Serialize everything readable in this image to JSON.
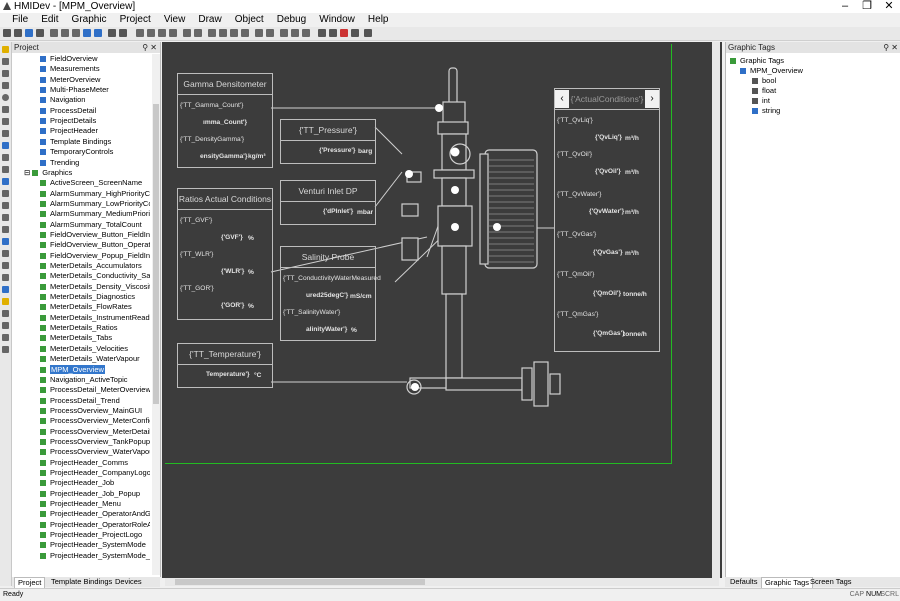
{
  "window": {
    "title": "HMIDev - [MPM_Overview]",
    "minimize": "–",
    "maximize": "❐",
    "close": "✕"
  },
  "menu": [
    "File",
    "Edit",
    "Graphic",
    "Project",
    "View",
    "Draw",
    "Object",
    "Debug",
    "Window",
    "Help"
  ],
  "project_panel": {
    "title": "Project",
    "pin": "⚲ ✕",
    "items": [
      {
        "label": "FieldOverview",
        "level": 2,
        "icon": "pg"
      },
      {
        "label": "Measurements",
        "level": 2,
        "icon": "pg"
      },
      {
        "label": "MeterOverview",
        "level": 2,
        "icon": "pg"
      },
      {
        "label": "Multi-PhaseMeter",
        "level": 2,
        "icon": "pg"
      },
      {
        "label": "Navigation",
        "level": 2,
        "icon": "pg"
      },
      {
        "label": "ProcessDetail",
        "level": 2,
        "icon": "pg"
      },
      {
        "label": "ProjectDetails",
        "level": 2,
        "icon": "pg"
      },
      {
        "label": "ProjectHeader",
        "level": 2,
        "icon": "pg"
      },
      {
        "label": "Template Bindings",
        "level": 2,
        "icon": "pg"
      },
      {
        "label": "TemporaryControls",
        "level": 2,
        "icon": "pg"
      },
      {
        "label": "Trending",
        "level": 2,
        "icon": "pg"
      },
      {
        "label": "Graphics",
        "level": 1,
        "icon": "gr",
        "expander": "⊟"
      },
      {
        "label": "ActiveScreen_ScreenName",
        "level": 2,
        "icon": "gr"
      },
      {
        "label": "AlarmSummary_HighPriorityCount",
        "level": 2,
        "icon": "gr"
      },
      {
        "label": "AlarmSummary_LowPriorityCount",
        "level": 2,
        "icon": "gr"
      },
      {
        "label": "AlarmSummary_MediumPriorityCount",
        "level": 2,
        "icon": "gr"
      },
      {
        "label": "AlarmSummary_TotalCount",
        "level": 2,
        "icon": "gr"
      },
      {
        "label": "FieldOverview_Button_FieldInfo",
        "level": 2,
        "icon": "gr"
      },
      {
        "label": "FieldOverview_Button_OperatorInfo",
        "level": 2,
        "icon": "gr"
      },
      {
        "label": "FieldOverview_Popup_FieldInfo",
        "level": 2,
        "icon": "gr"
      },
      {
        "label": "MeterDetails_Accumulators",
        "level": 2,
        "icon": "gr"
      },
      {
        "label": "MeterDetails_Conductivity_Salinity",
        "level": 2,
        "icon": "gr"
      },
      {
        "label": "MeterDetails_Density_Viscosity",
        "level": 2,
        "icon": "gr"
      },
      {
        "label": "MeterDetails_Diagnostics",
        "level": 2,
        "icon": "gr"
      },
      {
        "label": "MeterDetails_FlowRates",
        "level": 2,
        "icon": "gr"
      },
      {
        "label": "MeterDetails_InstrumentReadings",
        "level": 2,
        "icon": "gr"
      },
      {
        "label": "MeterDetails_Ratios",
        "level": 2,
        "icon": "gr"
      },
      {
        "label": "MeterDetails_Tabs",
        "level": 2,
        "icon": "gr"
      },
      {
        "label": "MeterDetails_Velocities",
        "level": 2,
        "icon": "gr"
      },
      {
        "label": "MeterDetails_WaterVapour",
        "level": 2,
        "icon": "gr"
      },
      {
        "label": "MPM_Overview",
        "level": 2,
        "icon": "gr",
        "selected": true
      },
      {
        "label": "Navigation_ActiveTopic",
        "level": 2,
        "icon": "gr"
      },
      {
        "label": "ProcessDetail_MeterOverview",
        "level": 2,
        "icon": "gr"
      },
      {
        "label": "ProcessDetail_Trend",
        "level": 2,
        "icon": "gr"
      },
      {
        "label": "ProcessOverview_MainGUI",
        "level": 2,
        "icon": "gr"
      },
      {
        "label": "ProcessOverview_MeterConfig",
        "level": 2,
        "icon": "gr"
      },
      {
        "label": "ProcessOverview_MeterDetails",
        "level": 2,
        "icon": "gr"
      },
      {
        "label": "ProcessOverview_TankPopup",
        "level": 2,
        "icon": "gr"
      },
      {
        "label": "ProcessOverview_WaterVapour",
        "level": 2,
        "icon": "gr"
      },
      {
        "label": "ProjectHeader_Comms",
        "level": 2,
        "icon": "gr"
      },
      {
        "label": "ProjectHeader_CompanyLogoAndProje",
        "level": 2,
        "icon": "gr"
      },
      {
        "label": "ProjectHeader_Job",
        "level": 2,
        "icon": "gr"
      },
      {
        "label": "ProjectHeader_Job_Popup",
        "level": 2,
        "icon": "gr"
      },
      {
        "label": "ProjectHeader_Menu",
        "level": 2,
        "icon": "gr"
      },
      {
        "label": "ProjectHeader_OperatorAndGroup",
        "level": 2,
        "icon": "gr"
      },
      {
        "label": "ProjectHeader_OperatorRoleAndField",
        "level": 2,
        "icon": "gr"
      },
      {
        "label": "ProjectHeader_ProjectLogo",
        "level": 2,
        "icon": "gr"
      },
      {
        "label": "ProjectHeader_SystemMode",
        "level": 2,
        "icon": "gr"
      },
      {
        "label": "ProjectHeader_SystemMode_Popup",
        "level": 2,
        "icon": "gr"
      }
    ],
    "tabs": [
      "Project",
      "Template Bindings",
      "Devices"
    ]
  },
  "canvas": {
    "gamma": {
      "title": "Gamma Densitometer",
      "rows": [
        {
          "label": "{'TT_Gamma_Count'}",
          "value": "ımma_Count'}",
          "unit": ""
        },
        {
          "label": "{'TT_DensityGamma'}",
          "value": "ensityGamma'}",
          "unit": "kg/m³"
        }
      ]
    },
    "pressure": {
      "title": "{'TT_Pressure'}",
      "value": "{'Pressure'}",
      "unit": "barg"
    },
    "venturi": {
      "title": "Venturi Inlet DP",
      "value": "{'dPInlet'}",
      "unit": "mbar"
    },
    "ratios": {
      "title": "Ratios Actual Conditions",
      "rows": [
        {
          "label": "{'TT_GVF'}",
          "value": "{'GVF'}",
          "unit": "%"
        },
        {
          "label": "{'TT_WLR'}",
          "value": "{'WLR'}",
          "unit": "%"
        },
        {
          "label": "{'TT_GOR'}",
          "value": "{'GOR'}",
          "unit": "%"
        }
      ]
    },
    "salinity": {
      "title": "Salinity Probe",
      "rows": [
        {
          "label": "{'TT_ConductivityWaterMeasured",
          "value": "ured25degC'}",
          "unit": "mS/cm"
        },
        {
          "label": "{'TT_SalinityWater'}",
          "value": "alinityWater'}",
          "unit": "%"
        }
      ]
    },
    "temperature": {
      "title": "{'TT_Temperature'}",
      "value": "Temperature'}",
      "unit": "°C"
    },
    "actual": {
      "title": "{'ActualConditions'}",
      "prev": "‹",
      "next": "›",
      "rows": [
        {
          "label": "{'TT_QvLiq'}",
          "value": "{'QvLiq'}",
          "unit": "m³/h"
        },
        {
          "label": "{'TT_QvOil'}",
          "value": "{'QvOil'}",
          "unit": "m³/h"
        },
        {
          "label": "{'TT_QvWater'}",
          "value": "{'QvWater'}",
          "unit": "m³/h"
        },
        {
          "label": "{'TT_QvGas'}",
          "value": "{'QvGas'}",
          "unit": "m³/h"
        },
        {
          "label": "{'TT_QmOil'}",
          "value": "{'QmOil'}",
          "unit": "tonne/h"
        },
        {
          "label": "{'TT_QmGas'}",
          "value": "{'QmGas'}",
          "unit": "tonne/h"
        }
      ]
    }
  },
  "tags_panel": {
    "title": "Graphic Tags",
    "pin": "⚲ ✕",
    "root": "Graphic Tags",
    "child": "MPM_Overview",
    "types": [
      "bool",
      "float",
      "int",
      "string"
    ],
    "tabs": [
      "Defaults",
      "Graphic Tags",
      "Screen Tags"
    ]
  },
  "status": {
    "left": "Ready",
    "right": [
      "CAP",
      "NUM",
      "SCRL"
    ]
  },
  "colors": {
    "canvas_bg": "#3c3c3c",
    "canvas_border": "#22bb22",
    "card_border": "#bdbdbd",
    "selection": "#3377cc"
  }
}
